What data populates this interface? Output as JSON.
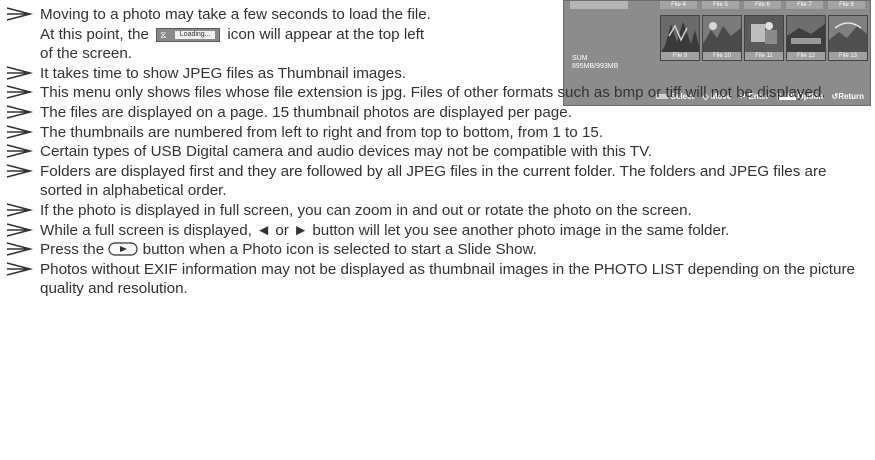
{
  "notes": [
    {
      "lines": [
        "Moving to a photo may take a few seconds to load the file."
      ],
      "cont_before": "At this point, the",
      "cont_after": "icon will appear at the top left",
      "last_line": "of the screen.",
      "loading_label": "Loading..."
    },
    {
      "text": "It takes time to show JPEG files as Thumbnail images."
    },
    {
      "text": "This menu only shows files whose file extension is jpg. Files of other formats such as bmp or tiff will not be displayed."
    },
    {
      "text": "The files are displayed on a page. 15 thumbnail photos are displayed per page."
    },
    {
      "text": "The thumbnails are numbered from left to right and from top to bottom, from 1 to 15."
    },
    {
      "text": "Certain types of USB Digital camera and audio devices may not be compatible with this TV."
    },
    {
      "text": "Folders are displayed first and they are followed by all JPEG files in the current folder. The folders and JPEG files are sorted in alphabetical order."
    },
    {
      "text": "If the photo is displayed in full screen, you can zoom in and out or rotate the photo on the screen."
    },
    {
      "text": "While a full screen is displayed, ◄ or ► button will let you see another photo image in the same folder."
    },
    {
      "text_before": "Press the",
      "text_after": "button when a Photo icon is selected to start a Slide Show."
    },
    {
      "text": "Photos without EXIF information may not be displayed as thumbnail images in the PHOTO LIST depending on the picture quality and resolution."
    }
  ],
  "panel": {
    "top_labels": [
      "File 4",
      "File 5",
      "File 6",
      "File 7",
      "File 8"
    ],
    "thumb_captions": [
      "File 9",
      "File 10",
      "File 11",
      "File 12",
      "File 13"
    ],
    "sum_label": "SUM",
    "sum_value": "895MB/993MB",
    "footer": {
      "select": "Select",
      "move": "Move",
      "enter": "Enter",
      "info_tag": "INFO",
      "option": "Option",
      "return": "Return"
    }
  }
}
